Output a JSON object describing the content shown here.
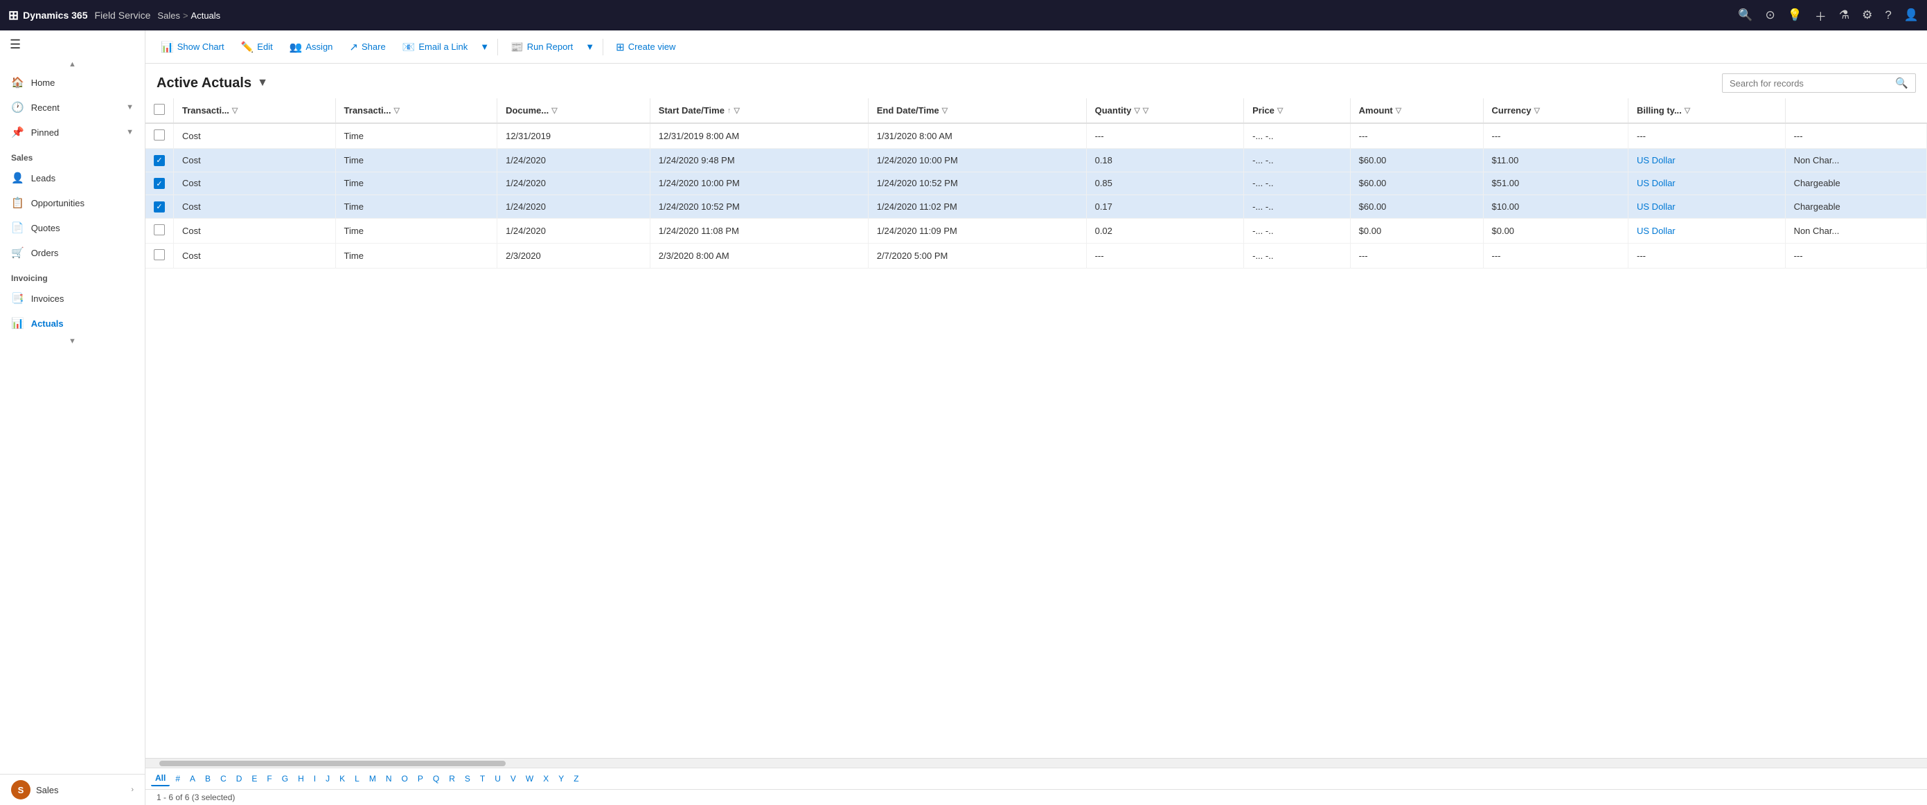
{
  "app": {
    "brand": "Dynamics 365",
    "module": "Field Service",
    "breadcrumb_parent": "Sales",
    "breadcrumb_sep": ">",
    "breadcrumb_current": "Actuals"
  },
  "top_nav_icons": [
    "search",
    "circle-check",
    "lightbulb",
    "plus",
    "filter",
    "settings",
    "question",
    "user"
  ],
  "toolbar": {
    "show_chart_label": "Show Chart",
    "edit_label": "Edit",
    "assign_label": "Assign",
    "share_label": "Share",
    "email_link_label": "Email a Link",
    "run_report_label": "Run Report",
    "create_view_label": "Create view"
  },
  "view": {
    "title": "Active Actuals",
    "search_placeholder": "Search for records"
  },
  "sidebar": {
    "hamburger_label": "☰",
    "nav_items": [
      {
        "id": "home",
        "label": "Home",
        "icon": "🏠"
      },
      {
        "id": "recent",
        "label": "Recent",
        "icon": "🕐",
        "has_chevron": true
      },
      {
        "id": "pinned",
        "label": "Pinned",
        "icon": "📌",
        "has_chevron": true
      }
    ],
    "section_sales": "Sales",
    "sales_items": [
      {
        "id": "leads",
        "label": "Leads",
        "icon": "👤"
      },
      {
        "id": "opportunities",
        "label": "Opportunities",
        "icon": "📋"
      },
      {
        "id": "quotes",
        "label": "Quotes",
        "icon": "📄"
      },
      {
        "id": "orders",
        "label": "Orders",
        "icon": "🛒"
      }
    ],
    "section_invoicing": "Invoicing",
    "invoicing_items": [
      {
        "id": "invoices",
        "label": "Invoices",
        "icon": "📑"
      },
      {
        "id": "actuals",
        "label": "Actuals",
        "icon": "📊",
        "active": true
      }
    ],
    "user": {
      "initials": "S",
      "name": "Sales"
    }
  },
  "grid": {
    "columns": [
      {
        "id": "transaction_category",
        "label": "Transacti...",
        "has_filter": true
      },
      {
        "id": "transaction_type",
        "label": "Transacti...",
        "has_filter": true
      },
      {
        "id": "document",
        "label": "Docume...",
        "has_filter": true
      },
      {
        "id": "start_datetime",
        "label": "Start Date/Time",
        "has_filter": true,
        "has_sort": true
      },
      {
        "id": "end_datetime",
        "label": "End Date/Time",
        "has_filter": true
      },
      {
        "id": "quantity",
        "label": "Quantity",
        "has_filter": true
      },
      {
        "id": "col_extra1",
        "label": "",
        "has_filter": true
      },
      {
        "id": "price",
        "label": "Price",
        "has_filter": true
      },
      {
        "id": "amount",
        "label": "Amount",
        "has_filter": true
      },
      {
        "id": "currency",
        "label": "Currency",
        "has_filter": true
      },
      {
        "id": "billing_type",
        "label": "Billing ty...",
        "has_filter": true
      }
    ],
    "rows": [
      {
        "id": "row1",
        "selected": false,
        "transaction_category": "Cost",
        "transaction_type": "Time",
        "document": "12/31/2019",
        "start_datetime": "12/31/2019 8:00 AM",
        "end_datetime": "1/31/2020 8:00 AM",
        "quantity": "---",
        "col_extra1": "-...",
        "col_extra2": "-..",
        "price": "---",
        "amount": "---",
        "currency": "---",
        "billing_type": "---"
      },
      {
        "id": "row2",
        "selected": true,
        "transaction_category": "Cost",
        "transaction_type": "Time",
        "document": "1/24/2020",
        "start_datetime": "1/24/2020 9:48 PM",
        "end_datetime": "1/24/2020 10:00 PM",
        "quantity": "0.18",
        "col_extra1": "-...",
        "col_extra2": "-..",
        "price": "$60.00",
        "amount": "$11.00",
        "currency": "US Dollar",
        "billing_type": "Non Char..."
      },
      {
        "id": "row3",
        "selected": true,
        "transaction_category": "Cost",
        "transaction_type": "Time",
        "document": "1/24/2020",
        "start_datetime": "1/24/2020 10:00 PM",
        "end_datetime": "1/24/2020 10:52 PM",
        "quantity": "0.85",
        "col_extra1": "-...",
        "col_extra2": "-..",
        "price": "$60.00",
        "amount": "$51.00",
        "currency": "US Dollar",
        "billing_type": "Chargeable"
      },
      {
        "id": "row4",
        "selected": true,
        "transaction_category": "Cost",
        "transaction_type": "Time",
        "document": "1/24/2020",
        "start_datetime": "1/24/2020 10:52 PM",
        "end_datetime": "1/24/2020 11:02 PM",
        "quantity": "0.17",
        "col_extra1": "-...",
        "col_extra2": "-..",
        "price": "$60.00",
        "amount": "$10.00",
        "currency": "US Dollar",
        "billing_type": "Chargeable"
      },
      {
        "id": "row5",
        "selected": false,
        "transaction_category": "Cost",
        "transaction_type": "Time",
        "document": "1/24/2020",
        "start_datetime": "1/24/2020 11:08 PM",
        "end_datetime": "1/24/2020 11:09 PM",
        "quantity": "0.02",
        "col_extra1": "-...",
        "col_extra2": "-..",
        "price": "$0.00",
        "amount": "$0.00",
        "currency": "US Dollar",
        "billing_type": "Non Char..."
      },
      {
        "id": "row6",
        "selected": false,
        "transaction_category": "Cost",
        "transaction_type": "Time",
        "document": "2/3/2020",
        "start_datetime": "2/3/2020 8:00 AM",
        "end_datetime": "2/7/2020 5:00 PM",
        "quantity": "---",
        "col_extra1": "-...",
        "col_extra2": "-..",
        "price": "---",
        "amount": "---",
        "currency": "---",
        "billing_type": "---"
      }
    ]
  },
  "alpha_bar": {
    "items": [
      "All",
      "#",
      "A",
      "B",
      "C",
      "D",
      "E",
      "F",
      "G",
      "H",
      "I",
      "J",
      "K",
      "L",
      "M",
      "N",
      "O",
      "P",
      "Q",
      "R",
      "S",
      "T",
      "U",
      "V",
      "W",
      "X",
      "Y",
      "Z"
    ],
    "active": "All"
  },
  "status_bar": {
    "text": "1 - 6 of 6 (3 selected)"
  }
}
